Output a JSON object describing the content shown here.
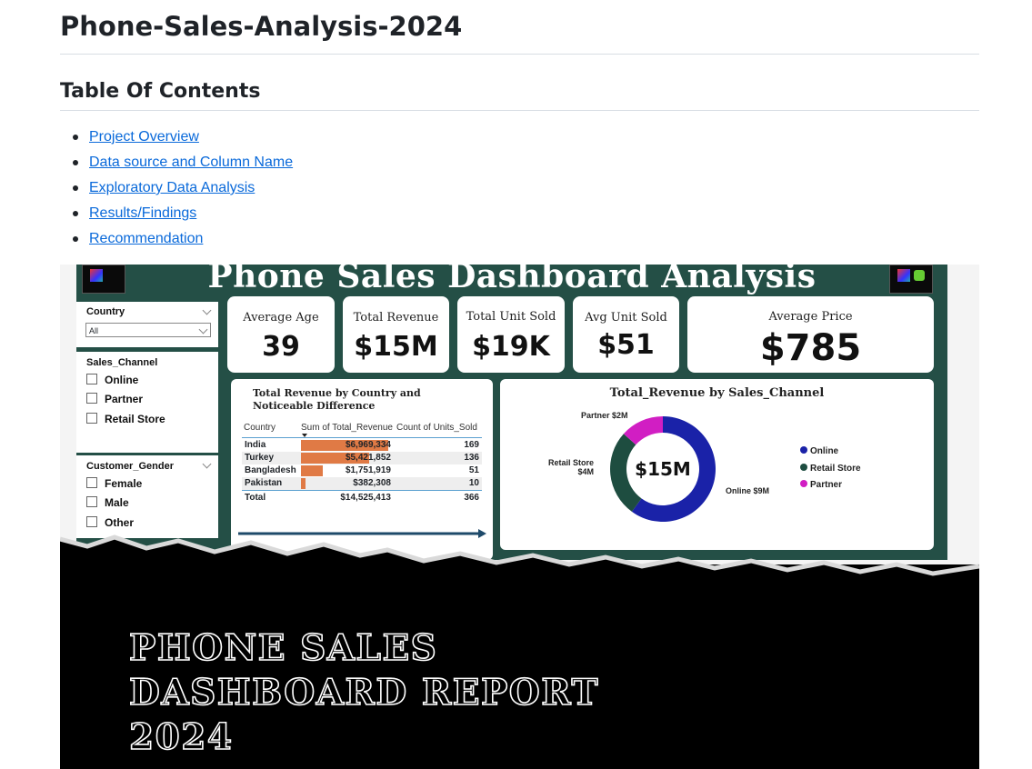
{
  "title": "Phone-Sales-Analysis-2024",
  "toc": {
    "heading": "Table Of Contents",
    "items": [
      "Project Overview",
      "Data source and Column Name",
      "Exploratory Data Analysis",
      "Results/Findings",
      "Recommendation"
    ]
  },
  "dashboard": {
    "title": "Phone Sales Dashboard Analysis",
    "kpis": [
      {
        "label": "Average Age",
        "value": "39"
      },
      {
        "label": "Total Revenue",
        "value": "$15M"
      },
      {
        "label": "Total Unit Sold",
        "value": "$19K"
      },
      {
        "label": "Avg Unit Sold",
        "value": "$51"
      },
      {
        "label": "Average Price",
        "value": "$785"
      }
    ],
    "slicers": {
      "country": {
        "title": "Country",
        "selected": "All"
      },
      "sales_channel": {
        "title": "Sales_Channel",
        "options": [
          "Online",
          "Partner",
          "Retail Store"
        ]
      },
      "customer_gender": {
        "title": "Customer_Gender",
        "options": [
          "Female",
          "Male",
          "Other"
        ]
      }
    },
    "table": {
      "title": "Total Revenue by Country and Noticeable Difference",
      "headers": [
        "Country",
        "Sum of Total_Revenue",
        "Count of Units_Sold"
      ],
      "rows": [
        {
          "country": "India",
          "revenue": "$6,969,334",
          "units": "169",
          "fraction": 1.0
        },
        {
          "country": "Turkey",
          "revenue": "$5,421,852",
          "units": "136",
          "fraction": 0.78
        },
        {
          "country": "Bangladesh",
          "revenue": "$1,751,919",
          "units": "51",
          "fraction": 0.25
        },
        {
          "country": "Pakistan",
          "revenue": "$382,308",
          "units": "10",
          "fraction": 0.055
        }
      ],
      "total": {
        "label": "Total",
        "revenue": "$14,525,413",
        "units": "366"
      }
    },
    "donut": {
      "title": "Total_Revenue by Sales_Channel",
      "center": "$15M",
      "labels": {
        "partner": "Partner $2M",
        "retail_line1": "Retail Store",
        "retail_line2": "$4M",
        "online": "Online $9M"
      },
      "legend": [
        "Online",
        "Retail Store",
        "Partner"
      ]
    }
  },
  "chart_data": {
    "type": "pie",
    "title": "Total_Revenue by Sales_Channel",
    "categories": [
      "Online",
      "Retail Store",
      "Partner"
    ],
    "values": [
      9,
      4,
      2
    ],
    "unit": "$M",
    "legend": "right"
  },
  "colors": {
    "online": "#1a22a8",
    "retail": "#1e4d40",
    "partner": "#d11ec3",
    "frame": "#244f46",
    "bar": "#e07a45",
    "link": "#0969da"
  },
  "report_title": [
    "PHONE SALES",
    "DASHBOARD REPORT",
    "2024"
  ]
}
